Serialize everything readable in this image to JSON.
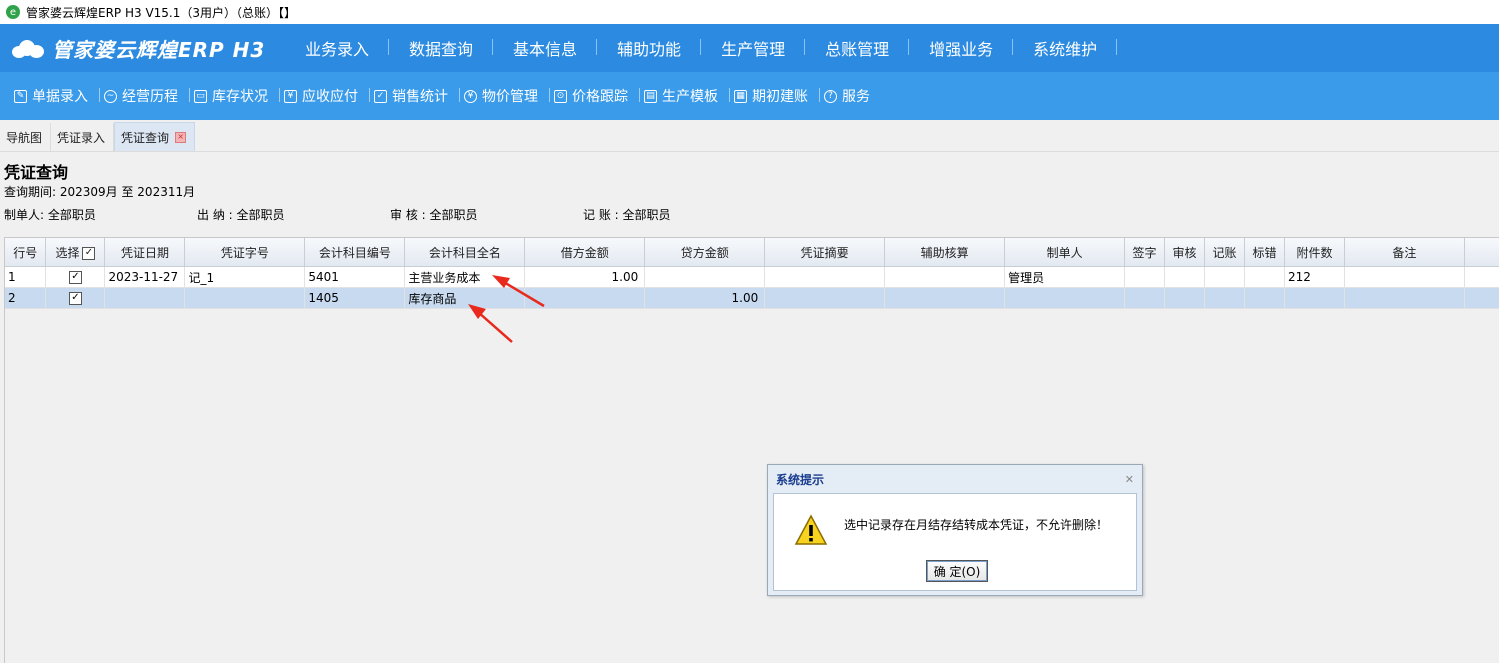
{
  "window": {
    "title": "管家婆云辉煌ERP H3 V15.1（3用户）（总账）【】"
  },
  "logo": {
    "text": "管家婆云辉煌ERP H3"
  },
  "menu": [
    "业务录入",
    "数据查询",
    "基本信息",
    "辅助功能",
    "生产管理",
    "总账管理",
    "增强业务",
    "系统维护"
  ],
  "toolbar": [
    {
      "label": "单据录入",
      "icon": "edit-icon",
      "glyph": "✎"
    },
    {
      "label": "经营历程",
      "icon": "chart-circle-icon",
      "glyph": "~"
    },
    {
      "label": "库存状况",
      "icon": "box-icon",
      "glyph": "▭"
    },
    {
      "label": "应收应付",
      "icon": "money-icon",
      "glyph": "¥"
    },
    {
      "label": "销售统计",
      "icon": "stats-icon",
      "glyph": "✓"
    },
    {
      "label": "物价管理",
      "icon": "yen-icon",
      "glyph": "¥"
    },
    {
      "label": "价格跟踪",
      "icon": "tracking-icon",
      "glyph": "⊙"
    },
    {
      "label": "生产模板",
      "icon": "template-icon",
      "glyph": "▤"
    },
    {
      "label": "期初建账",
      "icon": "ledger-icon",
      "glyph": "▦"
    },
    {
      "label": "服务",
      "icon": "help-icon",
      "glyph": "?"
    }
  ],
  "tabs": [
    {
      "label": "导航图",
      "active": false
    },
    {
      "label": "凭证录入",
      "active": false
    },
    {
      "label": "凭证查询",
      "active": true
    }
  ],
  "page": {
    "title": "凭证查询",
    "period": "查询期间:  202309月 至 202311月",
    "filters": [
      "制单人:  全部职员",
      "出 纳 :  全部职员",
      "审 核 :  全部职员",
      "记 账 :  全部职员"
    ]
  },
  "table": {
    "columns": [
      "行号",
      "选择",
      "凭证日期",
      "凭证字号",
      "会计科目编号",
      "会计科目全名",
      "借方金额",
      "贷方金额",
      "凭证摘要",
      "辅助核算",
      "制单人",
      "签字",
      "审核",
      "记账",
      "标错",
      "附件数",
      "备注"
    ],
    "rows": [
      {
        "no": "1",
        "checked": "✓",
        "date": "2023-11-27",
        "voucher": "记_1",
        "code": "5401",
        "name": "主营业务成本",
        "debit": "1.00",
        "credit": "",
        "summary": "",
        "aux": "",
        "maker": "管理员",
        "sign": "",
        "audit": "",
        "post": "",
        "mark": "",
        "attach": "212",
        "remark": ""
      },
      {
        "no": "2",
        "checked": "✓",
        "date": "",
        "voucher": "",
        "code": "1405",
        "name": "库存商品",
        "debit": "",
        "credit": "1.00",
        "summary": "",
        "aux": "",
        "maker": "",
        "sign": "",
        "audit": "",
        "post": "",
        "mark": "",
        "attach": "",
        "remark": ""
      }
    ]
  },
  "dialog": {
    "title": "系统提示",
    "message": "选中记录存在月结存结转成本凭证，不允许删除！",
    "ok_label": "确 定(O)",
    "close_glyph": "✕"
  },
  "colors": {
    "menubar": "#2c8be0",
    "toolbar": "#3a9bea",
    "arrow": "#e8291c",
    "selected_row": "#c7daf0"
  }
}
